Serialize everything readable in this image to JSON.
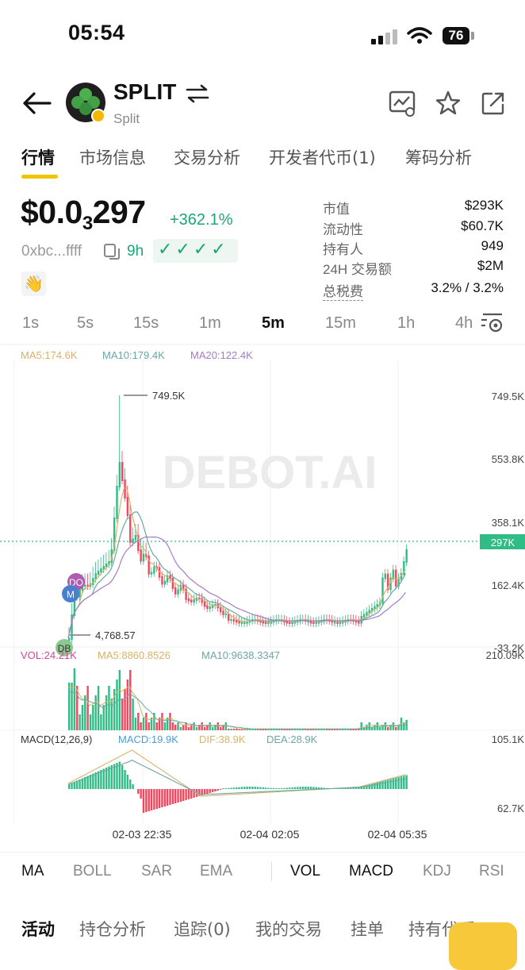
{
  "status_bar": {
    "time": "05:54",
    "battery": "76"
  },
  "header": {
    "title": "SPLIT",
    "subtitle": "Split"
  },
  "tabs": [
    {
      "label": "行情",
      "active": true
    },
    {
      "label": "市场信息"
    },
    {
      "label": "交易分析"
    },
    {
      "label": "开发者代币(1)"
    },
    {
      "label": "筹码分析"
    }
  ],
  "token": {
    "price_prefix": "$0.0",
    "price_sub": "3",
    "price_suffix": "297",
    "change": "+362.1%",
    "address": "0xbc...ffff",
    "age": "9h",
    "checks": "✓✓✓✓"
  },
  "stats": [
    {
      "label": "市值",
      "value": "$293K"
    },
    {
      "label": "流动性",
      "value": "$60.7K"
    },
    {
      "label": "持有人",
      "value": "949"
    },
    {
      "label": "24H 交易额",
      "value": "$2M"
    },
    {
      "label": "总税费",
      "value": "3.2% / 3.2%"
    }
  ],
  "intervals": [
    "1s",
    "5s",
    "15s",
    "1m",
    "5m",
    "15m",
    "1h",
    "4h"
  ],
  "active_interval": "5m",
  "chart": {
    "ma_legend": {
      "ma5": "MA5:174.6K",
      "ma10": "MA10:179.4K",
      "ma20": "MA20:122.4K"
    },
    "watermark": "DEBOT.AI",
    "high_label": "749.5K",
    "low_label": "4,768.57",
    "y_labels": [
      "749.5K",
      "553.8K",
      "358.1K",
      "162.4K",
      "-33.2K"
    ],
    "current_price_label": "297K",
    "markers": {
      "do": "DO",
      "m": "M",
      "db": "DB"
    },
    "vol_legend": {
      "vol": "VOL:24.21K",
      "ma5": "MA5:8860.8526",
      "ma10": "MA10:9638.3347"
    },
    "vol_axis": [
      "210.09K",
      "105.1K"
    ],
    "macd_legend": {
      "name": "MACD(12,26,9)",
      "macd": "MACD:19.9K",
      "dif": "DIF:38.9K",
      "dea": "DEA:28.9K"
    },
    "macd_axis": "62.7K",
    "x_labels": [
      "02-03 22:35",
      "02-04 02:05",
      "02-04 05:35"
    ],
    "colors": {
      "up": "#2ebd85",
      "down": "#f6465d",
      "ma5": "#d8b26a",
      "ma10": "#6aa7a6",
      "ma20": "#a77cc4"
    }
  },
  "indicators_left": [
    "MA",
    "BOLL",
    "SAR",
    "EMA"
  ],
  "indicators_right": [
    "VOL",
    "MACD",
    "KDJ",
    "RSI"
  ],
  "bottom_tabs": [
    {
      "label": "活动",
      "active": true
    },
    {
      "label": "持仓分析"
    },
    {
      "label": "追踪(0)"
    },
    {
      "label": "我的交易"
    },
    {
      "label": "挂单"
    },
    {
      "label": "持有代币"
    }
  ]
}
